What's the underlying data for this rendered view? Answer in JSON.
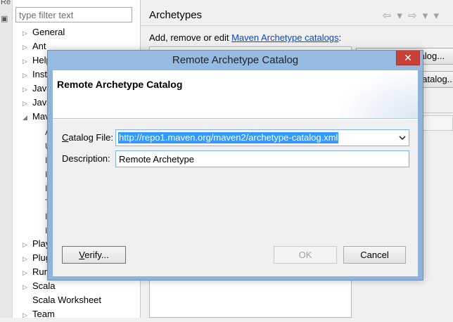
{
  "left_edge_fragments": [
    "Re",
    "▣"
  ],
  "filter": {
    "placeholder": "type filter text"
  },
  "tree": {
    "items": [
      {
        "label": "General",
        "arrow": "▷"
      },
      {
        "label": "Ant",
        "arrow": "▷"
      },
      {
        "label": "Help",
        "arrow": "▷"
      },
      {
        "label": "Inst",
        "arrow": "▷"
      },
      {
        "label": "Java",
        "arrow": "▷"
      },
      {
        "label": "Java",
        "arrow": "▷"
      },
      {
        "label": "Mav",
        "arrow": "◢"
      },
      {
        "label": "Play",
        "arrow": "▷"
      },
      {
        "label": "Plug",
        "arrow": "▷"
      },
      {
        "label": "Run",
        "arrow": "▷"
      },
      {
        "label": "Scala",
        "arrow": "▷"
      },
      {
        "label": "Scala Worksheet",
        "arrow": ""
      },
      {
        "label": "Team",
        "arrow": "▷"
      }
    ],
    "sub_fragments": [
      "A",
      "I",
      "I",
      "I",
      "I",
      "T",
      "I",
      "U"
    ]
  },
  "preferences": {
    "title": "Archetypes",
    "nav_icons": "⇦ ▾ ⇨ ▾ ▾",
    "description_prefix": "Add, remove or edit ",
    "catalogs_link": "Maven Archetype catalogs",
    "description_suffix": ":",
    "side_buttons": [
      "Add Local Catalog...",
      "Add Remote Catalog..."
    ]
  },
  "dialog": {
    "title": "Remote Archetype Catalog",
    "close_glyph": "✕",
    "banner_title": "Remote Archetype Catalog",
    "catalog_file_label_mnemonic": "C",
    "catalog_file_label_rest": "atalog File:",
    "catalog_file_value": "http://repo1.maven.org/maven2/archetype-catalog.xml",
    "description_label": "Description:",
    "description_value": "Remote Archetype",
    "verify_mnemonic": "V",
    "verify_rest": "erify...",
    "ok_label": "OK",
    "cancel_label": "Cancel"
  },
  "colors": {
    "dialog_frame": "#8fb3d9",
    "close_button": "#c7423b",
    "selection": "#3399ff",
    "link": "#0645c8"
  },
  "icons": {
    "dropdown": "chevron-down-icon",
    "close": "close-icon",
    "back": "back-arrow-icon",
    "forward": "forward-arrow-icon"
  }
}
